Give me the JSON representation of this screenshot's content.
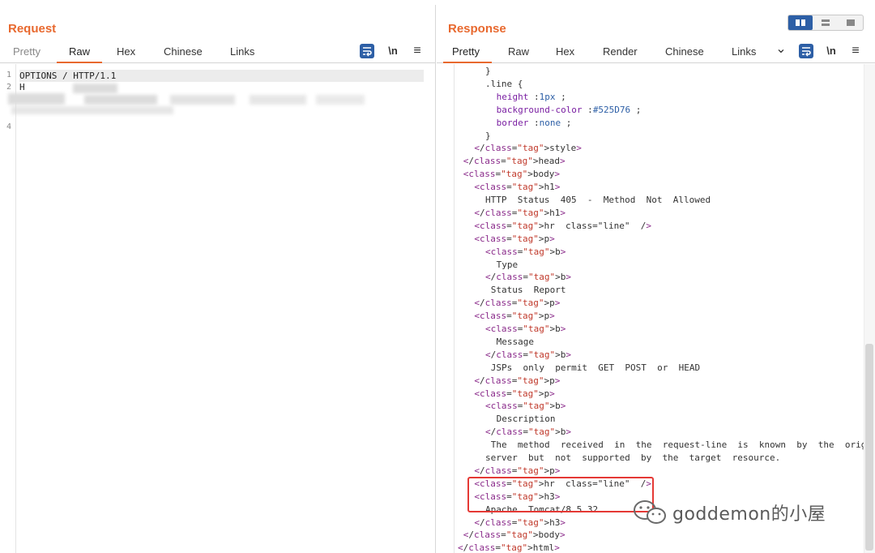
{
  "request": {
    "title": "Request",
    "tabs": [
      "Pretty",
      "Raw",
      "Hex",
      "Chinese",
      "Links"
    ],
    "active_tab": "Raw",
    "wrap_label": "\\n",
    "menu_label": "≡",
    "line_numbers": [
      "1",
      "2",
      "4"
    ],
    "first_line": "OPTIONS  / HTTP/1.1",
    "second_line_start": "H"
  },
  "response": {
    "title": "Response",
    "tabs": [
      "Pretty",
      "Raw",
      "Hex",
      "Render",
      "Chinese",
      "Links"
    ],
    "active_tab": "Pretty",
    "chevron": "⌄",
    "wrap_label": "\\n",
    "menu_label": "≡",
    "lines": [
      {
        "t": "}",
        "indent": 5
      },
      {
        "t": ".line {",
        "indent": 5
      },
      {
        "t": "height :1px ;",
        "indent": 7
      },
      {
        "t": "background-color :#525D76 ;",
        "indent": 7
      },
      {
        "t": "border :none ;",
        "indent": 7
      },
      {
        "t": "}",
        "indent": 5
      },
      {
        "t": "</style>",
        "indent": 3
      },
      {
        "t": "</head>",
        "indent": 1
      },
      {
        "t": "<body>",
        "indent": 1
      },
      {
        "t": "<h1>",
        "indent": 3
      },
      {
        "t": "HTTP  Status  405  -  Method  Not  Allowed",
        "indent": 5
      },
      {
        "t": "</h1>",
        "indent": 3
      },
      {
        "t": "<hr  class=\"line\"  />",
        "indent": 3
      },
      {
        "t": "<p>",
        "indent": 3
      },
      {
        "t": "<b>",
        "indent": 5
      },
      {
        "t": "Type",
        "indent": 7
      },
      {
        "t": "</b>",
        "indent": 5
      },
      {
        "t": "Status  Report",
        "indent": 6
      },
      {
        "t": "</p>",
        "indent": 3
      },
      {
        "t": "<p>",
        "indent": 3
      },
      {
        "t": "<b>",
        "indent": 5
      },
      {
        "t": "Message",
        "indent": 7
      },
      {
        "t": "</b>",
        "indent": 5
      },
      {
        "t": "JSPs  only  permit  GET  POST  or  HEAD",
        "indent": 6
      },
      {
        "t": "</p>",
        "indent": 3
      },
      {
        "t": "<p>",
        "indent": 3
      },
      {
        "t": "<b>",
        "indent": 5
      },
      {
        "t": "Description",
        "indent": 7
      },
      {
        "t": "</b>",
        "indent": 5
      },
      {
        "t": "The  method  received  in  the  request-line  is  known  by  the  origin",
        "indent": 6
      },
      {
        "t": "server  but  not  supported  by  the  target  resource.",
        "indent": 5
      },
      {
        "t": "</p>",
        "indent": 3
      },
      {
        "t": "<hr  class=\"line\"  />",
        "indent": 3
      },
      {
        "t": "<h3>",
        "indent": 3
      },
      {
        "t": "Apache  Tomcat/8.5.32",
        "indent": 5
      },
      {
        "t": "</h3>",
        "indent": 3
      },
      {
        "t": "</body>",
        "indent": 1
      },
      {
        "t": "</html>",
        "indent": 0
      }
    ]
  },
  "watermark": {
    "text": "goddemon的小屋"
  },
  "colors": {
    "accent": "#e8692f",
    "active_blue": "#2d5fa6",
    "highlight": "#e53935"
  }
}
